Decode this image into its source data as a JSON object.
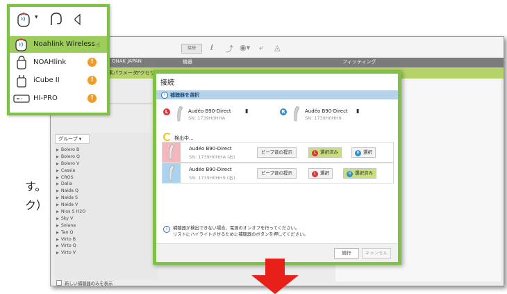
{
  "background_app": {
    "connect_button": "接続",
    "header": {
      "left": "ONAK JAPAN",
      "center": "機器",
      "right": "フィッティング"
    },
    "tabs": [
      "要素パラメータ",
      "アクセサ"
    ],
    "groups_button": "グループ ▾",
    "groups": [
      "Bolero B",
      "Bolero Q",
      "Bolero V",
      "Cassia",
      "CROS",
      "Dalia",
      "Naida Q",
      "Naida S",
      "Naida V",
      "Nios S H2O",
      "Sky V",
      "Solana",
      "Tao Q",
      "Virto B",
      "Virto Q",
      "Virto V"
    ],
    "show_new_only": "新しい補聴器のみを表示"
  },
  "side_text": {
    "line1": "す。",
    "line2": "ク）"
  },
  "dialog": {
    "title": "接続",
    "section_label": "補聴器を選択",
    "selected_left": {
      "badge": "L",
      "model": "Audéo B90-Direct",
      "sn": "SN: 1739H0HHA"
    },
    "selected_right": {
      "badge": "R",
      "model": "Audéo B90-Direct",
      "sn": "SN: 1739H0HH9"
    },
    "searching": "検出中...",
    "devices": [
      {
        "model": "Audéo B90-Direct",
        "sn": "SN: 1739H0HHA (右)",
        "beep": "ビープ音の提示",
        "left_btn": "選択済み",
        "right_btn": "選択",
        "swatch": "#f2b8bd"
      },
      {
        "model": "Audéo B90-Direct",
        "sn": "SN: 1739H0HH9 (右)",
        "beep": "ビープ音の提示",
        "left_btn": "選択",
        "right_btn": "選択済み",
        "swatch": "#a9d3ee"
      }
    ],
    "info_line1": "補聴器が検出できない場合、電源のオンオフを行ってください。",
    "info_line2": "リストにハイライトさせるために補聴器のボタンを押してください。",
    "continue_button": "続行",
    "cancel_button": "キャンセル"
  },
  "dropdown": {
    "items": [
      {
        "label": "Noahlink Wireless",
        "icon": "noahlink-wireless-icon",
        "selected": true
      },
      {
        "label": "NOAHlink",
        "icon": "noahlink-icon",
        "selected": false
      },
      {
        "label": "iCube II",
        "icon": "icube-icon",
        "selected": false
      },
      {
        "label": "HI-PRO",
        "icon": "hipro-icon",
        "selected": false
      }
    ]
  },
  "colors": {
    "highlight_green": "#7dc242",
    "selected_green": "#9ccd5b",
    "warning_orange": "#f39c1f",
    "left_red": "#e0353b",
    "right_blue": "#2f8fd0",
    "arrow_red": "#e8201a"
  }
}
